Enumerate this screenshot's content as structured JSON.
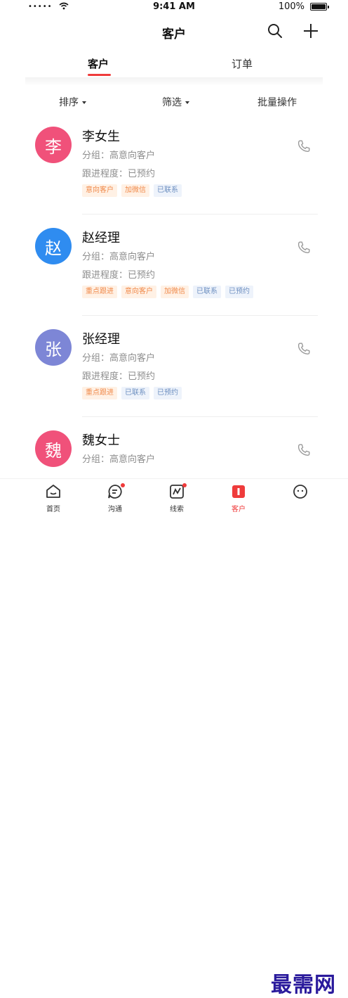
{
  "status_bar": {
    "signal": "•••••",
    "time": "9:41 AM",
    "battery_pct": "100%"
  },
  "header": {
    "title": "客户",
    "search_icon": "search-icon",
    "add_icon": "plus-icon"
  },
  "tabs": [
    {
      "label": "客户",
      "active": true
    },
    {
      "label": "订单",
      "active": false
    }
  ],
  "filters": {
    "sort": "排序",
    "filter": "筛选",
    "batch": "批量操作"
  },
  "customers": [
    {
      "avatar": "李",
      "avatar_color": "#f0517a",
      "name": "李女生",
      "group": "分组：高意向客户",
      "progress": "跟进程度：已预约",
      "tags": [
        {
          "text": "意向客户",
          "style": "orange"
        },
        {
          "text": "加微信",
          "style": "orange"
        },
        {
          "text": "已联系",
          "style": "blue"
        }
      ]
    },
    {
      "avatar": "赵",
      "avatar_color": "#2f8cf0",
      "name": "赵经理",
      "group": "分组：高意向客户",
      "progress": "跟进程度：已预约",
      "tags": [
        {
          "text": "重点跟进",
          "style": "orange"
        },
        {
          "text": "意向客户",
          "style": "orange"
        },
        {
          "text": "加微信",
          "style": "orange"
        },
        {
          "text": "已联系",
          "style": "blue"
        },
        {
          "text": "已预约",
          "style": "blue"
        }
      ]
    },
    {
      "avatar": "张",
      "avatar_color": "#7d86d6",
      "name": "张经理",
      "group": "分组：高意向客户",
      "progress": "跟进程度：已预约",
      "tags": [
        {
          "text": "重点跟进",
          "style": "orange"
        },
        {
          "text": "已联系",
          "style": "blue"
        },
        {
          "text": "已预约",
          "style": "blue"
        }
      ]
    },
    {
      "avatar": "魏",
      "avatar_color": "#f0517a",
      "name": "魏女士",
      "group": "分组：高意向客户",
      "progress": "",
      "tags": []
    }
  ],
  "bottom_tabs": [
    {
      "label": "首页",
      "icon": "home-icon",
      "badge": false,
      "active": false
    },
    {
      "label": "沟通",
      "icon": "chat-icon",
      "badge": true,
      "active": false
    },
    {
      "label": "线索",
      "icon": "leads-icon",
      "badge": true,
      "active": false
    },
    {
      "label": "客户",
      "icon": "customer-icon",
      "badge": false,
      "active": true
    },
    {
      "label": "",
      "icon": "profile-icon",
      "badge": false,
      "active": false
    }
  ],
  "watermark": "最需网",
  "colors": {
    "accent": "#ef3b3b",
    "tag_orange": "#f08a4b",
    "tag_blue": "#6d8fc0"
  }
}
